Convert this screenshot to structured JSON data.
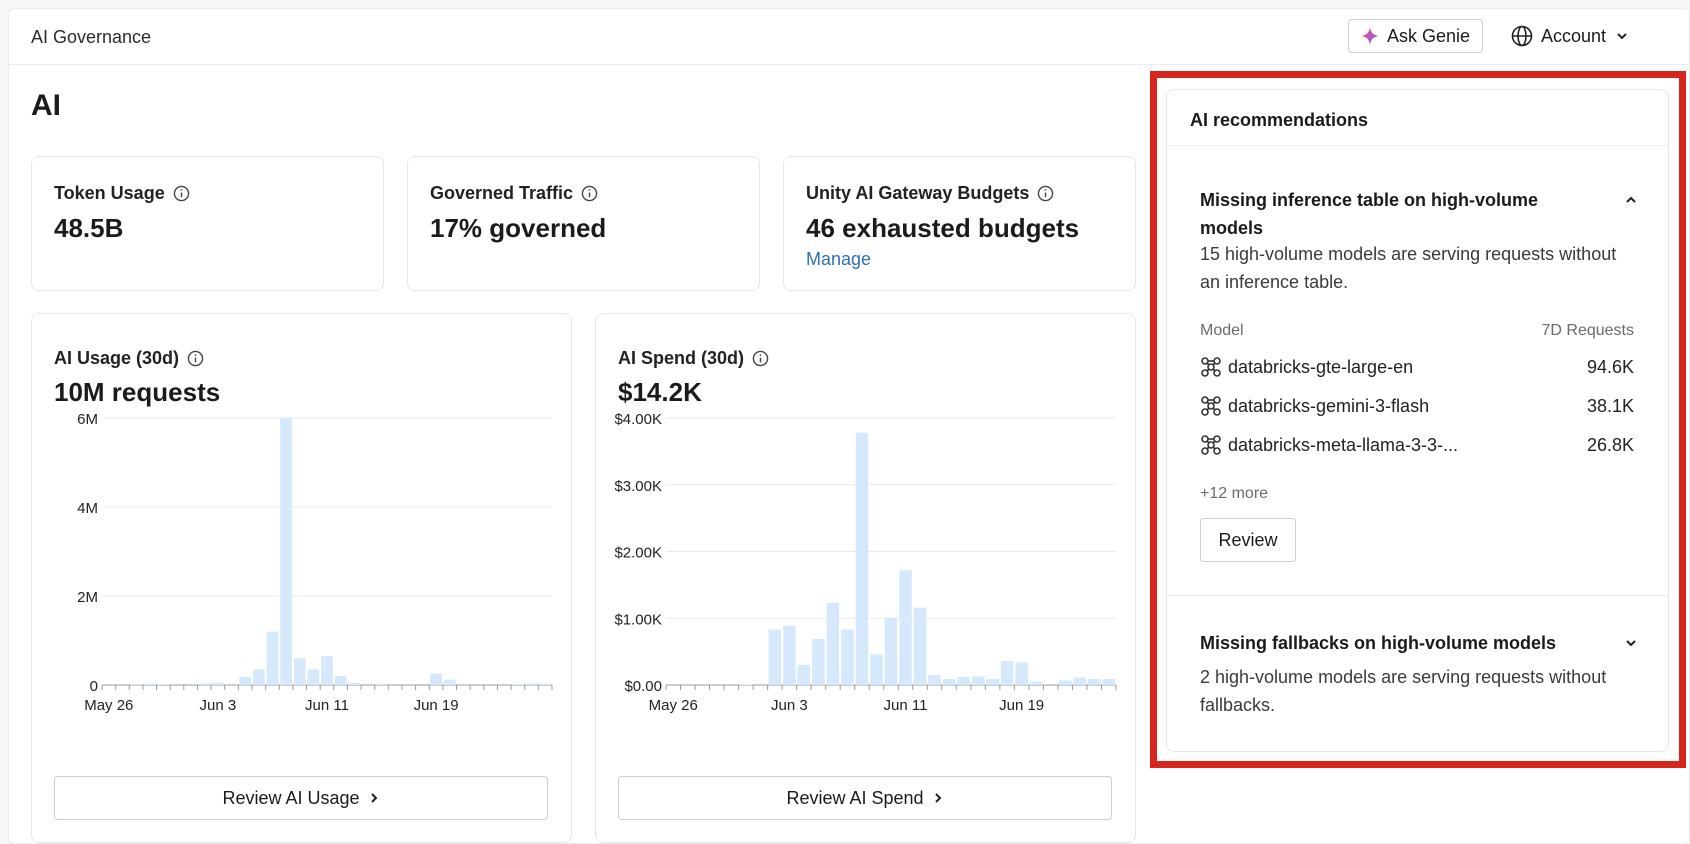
{
  "header": {
    "app_title": "AI Governance",
    "genie_label": "Ask Genie",
    "account_label": "Account"
  },
  "page": {
    "title": "AI"
  },
  "stats": [
    {
      "label": "Token Usage",
      "value": "48.5B"
    },
    {
      "label": "Governed Traffic",
      "value": "17% governed"
    },
    {
      "label": "Unity AI Gateway Budgets",
      "value": "46 exhausted budgets",
      "link": "Manage"
    }
  ],
  "usage_card": {
    "label": "AI Usage (30d)",
    "value": "10M requests",
    "button": "Review AI Usage"
  },
  "spend_card": {
    "label": "AI Spend (30d)",
    "value": "$14.2K",
    "button": "Review AI Spend"
  },
  "chart_data": [
    {
      "type": "bar",
      "ylim": [
        0,
        6000000
      ],
      "yticks": [
        "6M",
        "4M",
        "2M",
        "0"
      ],
      "xticks": [
        "May 26",
        "Jun 3",
        "Jun 11",
        "Jun 19"
      ],
      "values": [
        0,
        0,
        20000,
        30000,
        20000,
        0,
        0,
        40000,
        50000,
        0,
        180000,
        350000,
        1200000,
        6000000,
        600000,
        350000,
        650000,
        200000,
        50000,
        0,
        30000,
        0,
        0,
        0,
        260000,
        120000,
        0,
        0,
        0,
        0,
        20000,
        40000,
        30000
      ],
      "grid": true,
      "color": "#d6e8fb"
    },
    {
      "type": "bar",
      "ylim": [
        0,
        4000
      ],
      "yticks": [
        "$4.00K",
        "$3.00K",
        "$2.00K",
        "$1.00K",
        "$0.00"
      ],
      "xticks": [
        "May 26",
        "Jun 3",
        "Jun 11",
        "Jun 19"
      ],
      "values": [
        0,
        0,
        0,
        0,
        0,
        10,
        0,
        830,
        890,
        300,
        690,
        1230,
        830,
        3780,
        460,
        1010,
        1720,
        1160,
        150,
        90,
        120,
        130,
        90,
        360,
        340,
        50,
        0,
        70,
        110,
        90,
        90
      ],
      "grid": true,
      "color": "#d6e8fb"
    }
  ],
  "recommendations": {
    "title": "AI recommendations",
    "items": [
      {
        "title": "Missing inference table on high-volume models",
        "description": "15 high-volume models are serving requests without an inference table.",
        "table_header": {
          "model": "Model",
          "requests": "7D Requests"
        },
        "models": [
          {
            "name": "databricks-gte-large-en",
            "requests": "94.6K"
          },
          {
            "name": "databricks-gemini-3-flash",
            "requests": "38.1K"
          },
          {
            "name": "databricks-meta-llama-3-3-...",
            "requests": "26.8K"
          }
        ],
        "more": "+12 more",
        "button": "Review"
      },
      {
        "title": "Missing fallbacks on high-volume models",
        "description": "2 high-volume models are serving requests without fallbacks."
      }
    ]
  },
  "colors": {
    "accent": "#2f6fb5",
    "highlight": "#d7261e",
    "bar": "#d6e8fb"
  },
  "icons": [
    "genie-sparkle-icon",
    "globe-icon",
    "chevron-down-icon",
    "info-icon",
    "chevron-right-icon",
    "chevron-up-icon",
    "model-graph-icon"
  ]
}
